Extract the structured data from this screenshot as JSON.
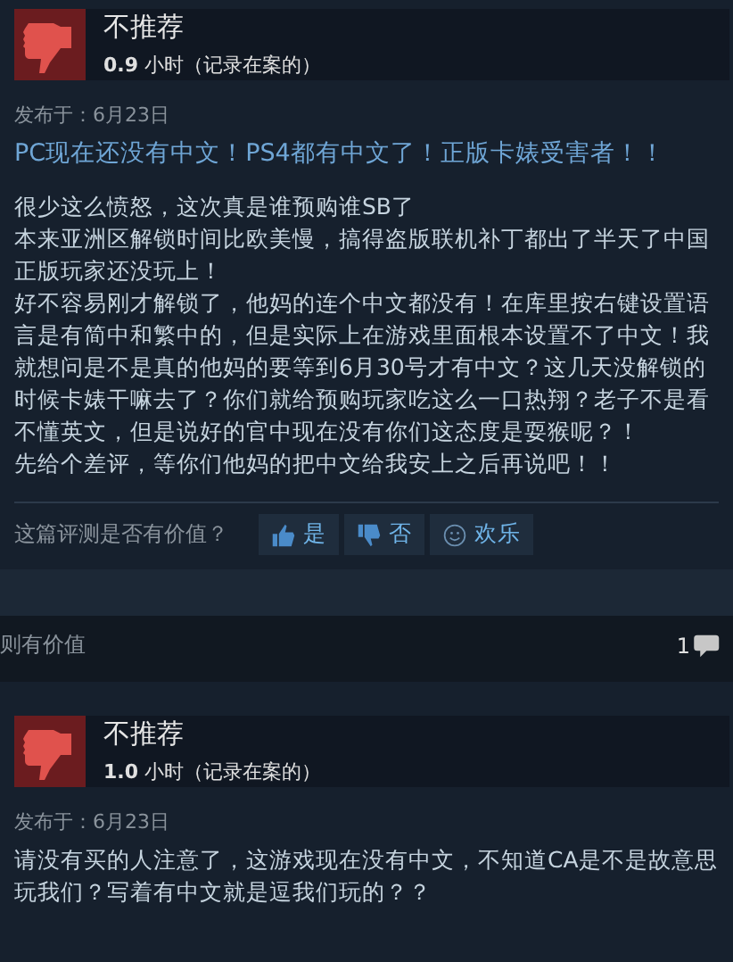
{
  "reviews": [
    {
      "verdict": "不推荐",
      "hours": "0.9",
      "hours_suffix": "小时（记录在案的）",
      "posted": "发布于：6月23日",
      "title": "PC现在还没有中文！PS4都有中文了！正版卡婊受害者！！",
      "paragraphs": [
        "很少这么愤怒，这次真是谁预购谁SB了",
        "本来亚洲区解锁时间比欧美慢，搞得盗版联机补丁都出了半天了中国正版玩家还没玩上！",
        "好不容易刚才解锁了，他妈的连个中文都没有！在库里按右键设置语言是有简中和繁中的，但是实际上在游戏里面根本设置不了中文！我就想问是不是真的他妈的要等到6月30号才有中文？这几天没解锁的时候卡婊干嘛去了？你们就给预购玩家吃这么一口热翔？老子不是看不懂英文，但是说好的官中现在没有你们这态度是耍猴呢？！",
        "先给个差评，等你们他妈的把中文给我安上之后再说吧！！"
      ],
      "vote_prompt": "这篇评测是否有价值？",
      "votes": [
        {
          "kind": "yes",
          "label": "是"
        },
        {
          "kind": "no",
          "label": "否"
        },
        {
          "kind": "funny",
          "label": "欢乐"
        }
      ],
      "helpful": "则有价值",
      "comments": "1"
    },
    {
      "verdict": "不推荐",
      "hours": "1.0",
      "hours_suffix": "小时（记录在案的）",
      "posted": "发布于：6月23日",
      "paragraphs": [
        "请没有买的人注意了，这游戏现在没有中文，不知道CA是不是故意思玩我们？写着有中文就是逗我们玩的？？"
      ]
    }
  ]
}
